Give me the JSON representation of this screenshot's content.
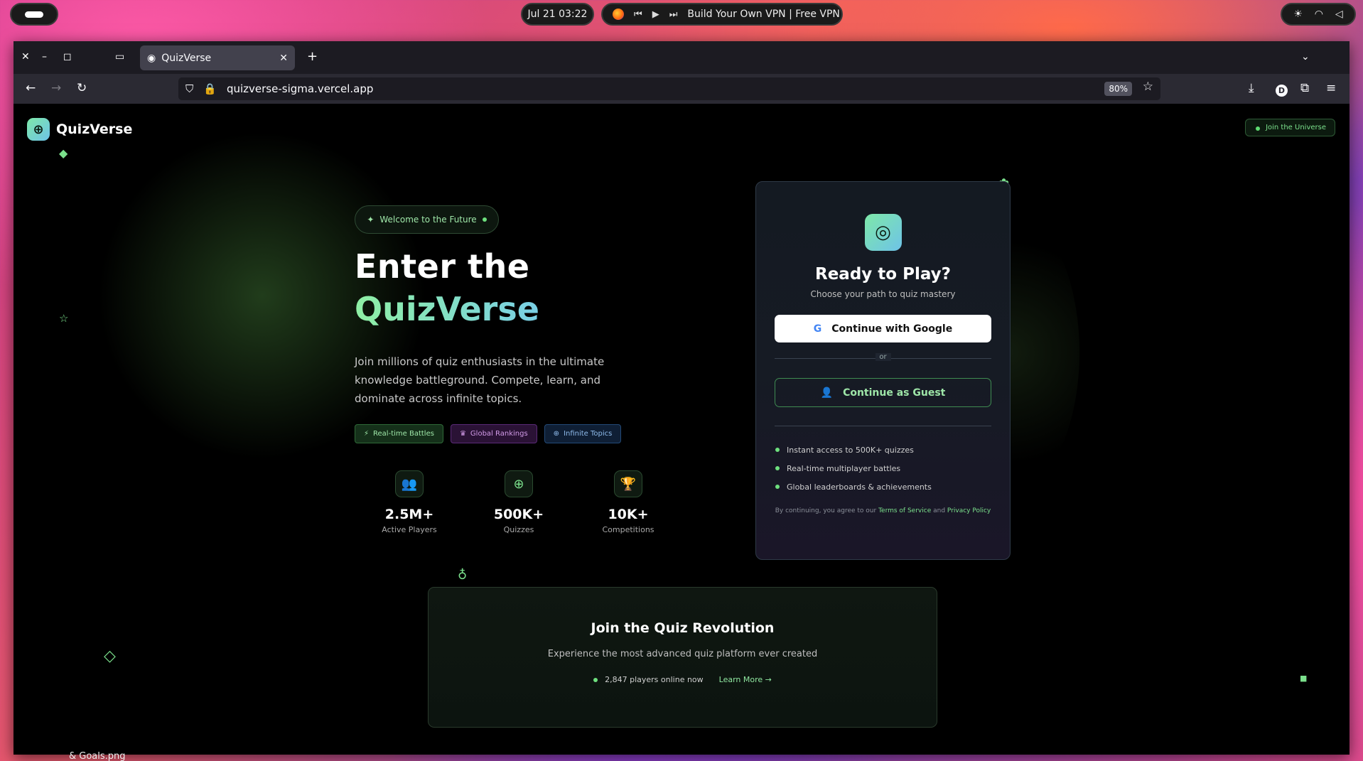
{
  "system": {
    "clock": "Jul 21  03:22",
    "media_title": "Build Your Own VPN | Free VPN"
  },
  "browser": {
    "tab_title": "QuizVerse",
    "url": "quizverse-sigma.vercel.app",
    "zoom": "80%",
    "profile_initial": "D"
  },
  "header": {
    "brand": "QuizVerse",
    "join_button": "Join the Universe"
  },
  "hero": {
    "welcome_pill": "Welcome to the Future",
    "title_line1": "Enter the",
    "title_line2": "QuizVerse",
    "description": "Join millions of quiz enthusiasts in the ultimate knowledge battleground. Compete, learn, and dominate across infinite topics.",
    "tags": [
      "Real-time Battles",
      "Global Rankings",
      "Infinite Topics"
    ],
    "stats": [
      {
        "value": "2.5M+",
        "label": "Active Players"
      },
      {
        "value": "500K+",
        "label": "Quizzes"
      },
      {
        "value": "10K+",
        "label": "Competitions"
      }
    ]
  },
  "login_card": {
    "title": "Ready to Play?",
    "subtitle": "Choose your path to quiz mastery",
    "google_button": "Continue with Google",
    "or_text": "or",
    "guest_button": "Continue as Guest",
    "features": [
      "Instant access to 500K+ quizzes",
      "Real-time multiplayer battles",
      "Global leaderboards & achievements"
    ],
    "legal_prefix": "By continuing, you agree to our",
    "terms_link": "Terms of Service",
    "and_text": "and",
    "privacy_link": "Privacy Policy"
  },
  "revolution": {
    "title": "Join the Quiz Revolution",
    "subtitle": "Experience the most advanced quiz platform ever created",
    "online_text": "2,847 players online now",
    "learn_more": "Learn More"
  },
  "desktop": {
    "file_label": "& Goals.png"
  }
}
